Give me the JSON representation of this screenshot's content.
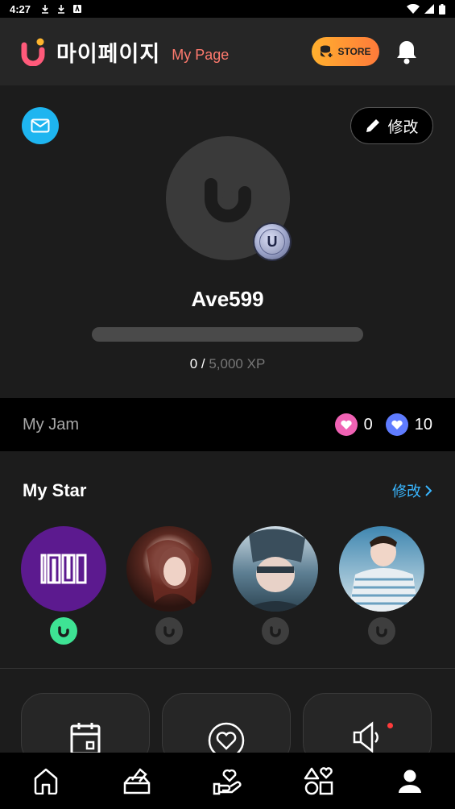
{
  "status_bar": {
    "time": "4:27"
  },
  "header": {
    "title": "마이페이지",
    "subtitle": "My Page",
    "store_label": "STORE"
  },
  "profile": {
    "edit_label": "修改",
    "level_badge": "U",
    "username": "Ave599",
    "xp_current": "0 /",
    "xp_max": "5,000 XP",
    "xp_progress": 0
  },
  "my_jam": {
    "label": "My Jam",
    "pink_heart_count": "0",
    "blue_heart_count": "10"
  },
  "my_star": {
    "title": "My Star",
    "edit_label": "修改",
    "stars": [
      {
        "name": "star-iu",
        "active": true,
        "bg": "#5c1a8f"
      },
      {
        "name": "star-2",
        "active": false,
        "bg": "#6e3b34"
      },
      {
        "name": "star-3",
        "active": false,
        "bg": "#4a6b80"
      },
      {
        "name": "star-4",
        "active": false,
        "bg": "#8cb4c8"
      }
    ]
  },
  "menu_cards": [
    {
      "icon": "calendar-icon"
    },
    {
      "icon": "heart-circle-icon"
    },
    {
      "icon": "speaker-icon",
      "has_notification": true
    }
  ],
  "bottom_nav": [
    {
      "icon": "home-icon"
    },
    {
      "icon": "vote-box-icon"
    },
    {
      "icon": "hand-heart-icon"
    },
    {
      "icon": "shapes-icon"
    },
    {
      "icon": "profile-icon",
      "active": true
    }
  ],
  "colors": {
    "accent_red": "#ff7a6e",
    "accent_blue": "#39b6ff",
    "store_orange": "#ff9a2e",
    "mail_blue": "#1eb5f0",
    "active_green": "#3ee394"
  }
}
